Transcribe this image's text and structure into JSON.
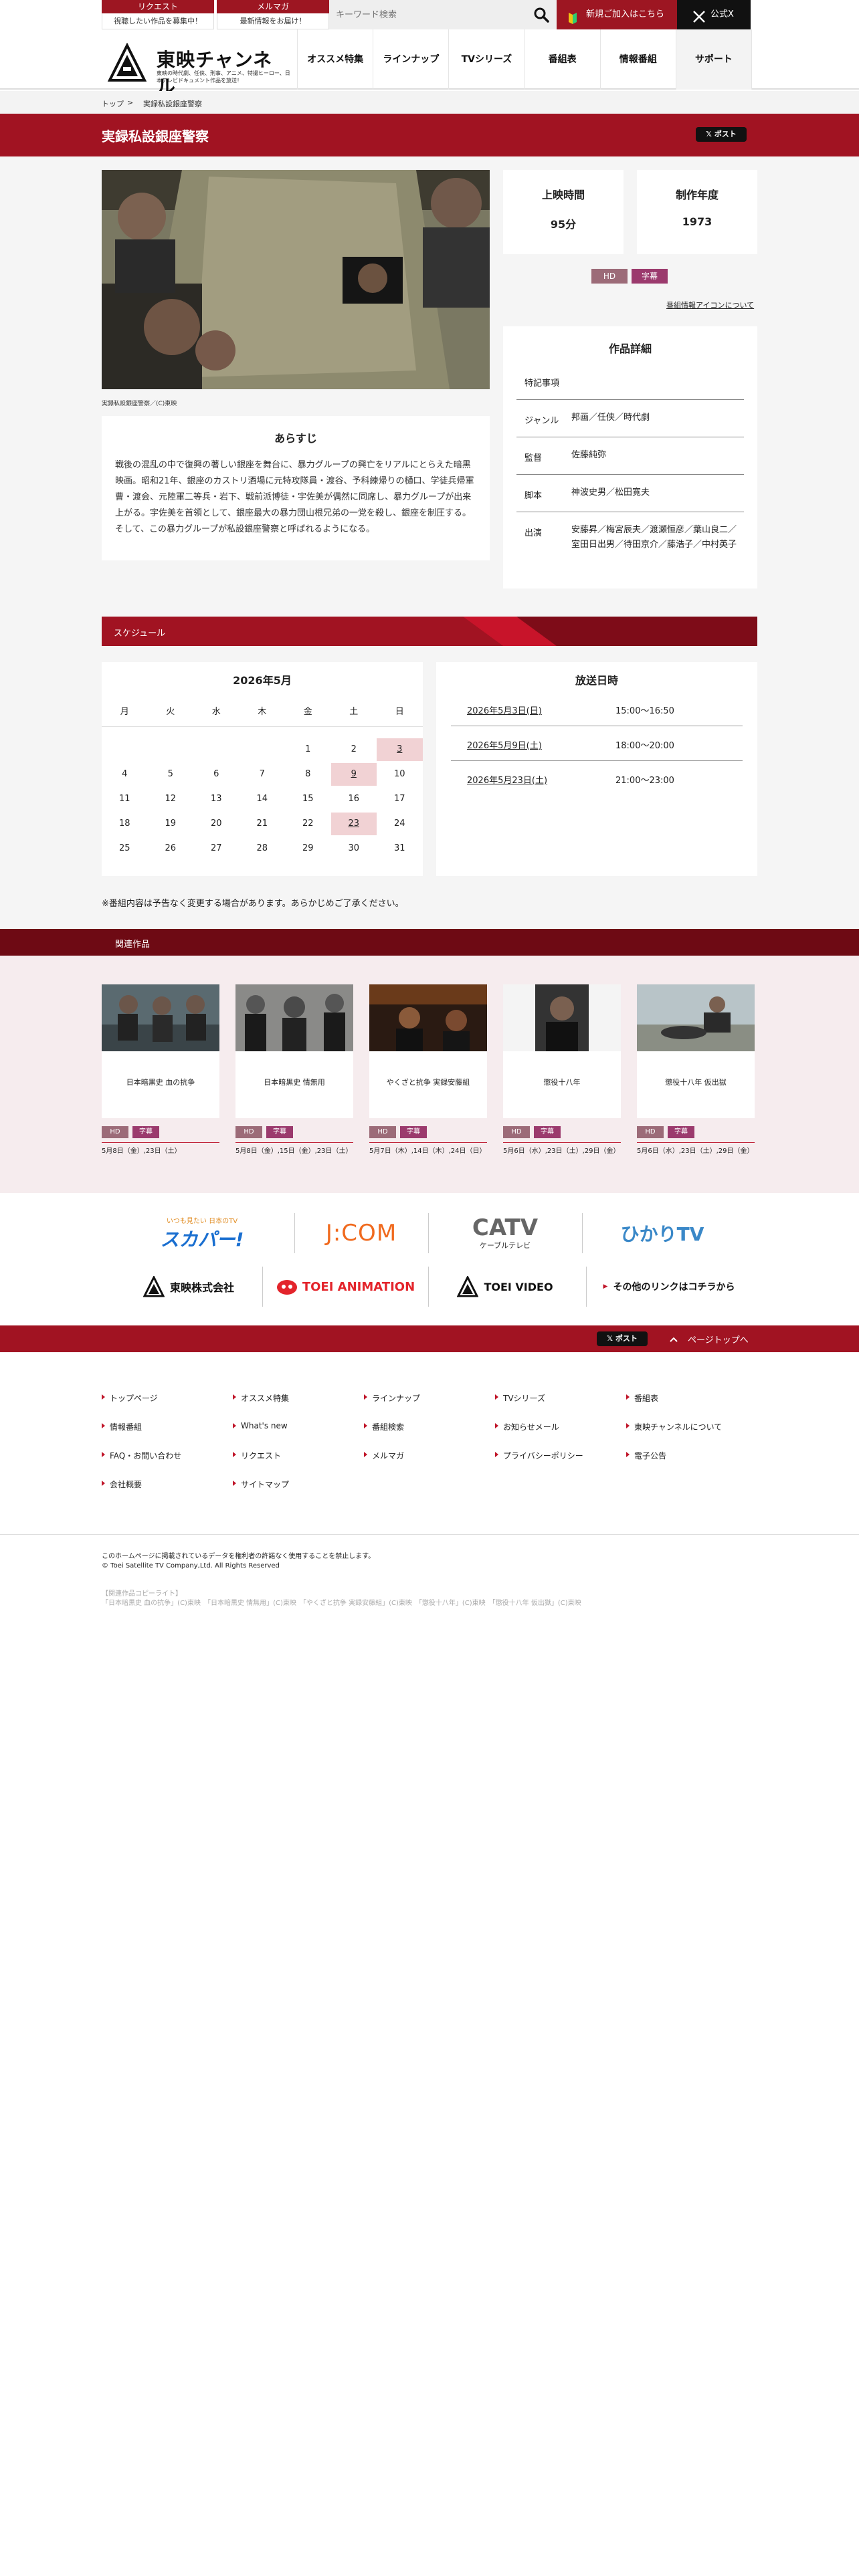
{
  "topbar": {
    "request_label": "リクエスト",
    "request_sub": "視聴したい作品を募集中！",
    "mailmag_label": "メルマガ",
    "mailmag_sub": "最新情報をお届け！",
    "search_placeholder": "キーワード検索",
    "newjoin_label": "新規ご加入はこちら",
    "x_label": "公式X"
  },
  "header": {
    "brand": "東映チャンネル",
    "tagline": "東映の時代劇、任侠、刑事、アニメ、特撮ヒーロー、日本テレビドキュメント作品を放送！",
    "nav": [
      "オススメ特集",
      "ラインナップ",
      "TVシリーズ",
      "番組表",
      "情報番組",
      "サポート"
    ]
  },
  "breadcrumb": {
    "home": "トップ",
    "sep": ">",
    "current": "実録私設銀座警察"
  },
  "title": {
    "text": "実録私設銀座警察",
    "post_label": "ポスト"
  },
  "photo_caption": "実録私設銀座警察／(C)東映",
  "synopsis": {
    "heading": "あらすじ",
    "text": "戦後の混乱の中で復興の著しい銀座を舞台に、暴力グループの興亡をリアルにとらえた暗黒映画。昭和21年、銀座のカストリ酒場に元特攻隊員・渡谷、予科練帰りの樋口、学徒兵帰軍曹・渡会、元陸軍二等兵・岩下、戦前派博徒・宇佐美が偶然に同席し、暴力グループが出来上がる。宇佐美を首領として、銀座最大の暴力団山根兄弟の一党を殺し、銀座を制圧する。そして、この暴力グループが私設銀座警察と呼ばれるようになる。"
  },
  "info": {
    "runtime_label": "上映時間",
    "runtime_value": "95分",
    "year_label": "制作年度",
    "year_value": "1973",
    "badge_hd": "HD",
    "badge_sub": "字幕",
    "icon_link": "番組情報アイコンについて"
  },
  "details": {
    "heading": "作品詳細",
    "rows": [
      {
        "key": "特記事項",
        "value": ""
      },
      {
        "key": "ジャンル",
        "value": "邦画／任侠／時代劇"
      },
      {
        "key": "監督",
        "value": "佐藤純弥"
      },
      {
        "key": "脚本",
        "value": "神波史男／松田寛夫"
      },
      {
        "key": "出演",
        "value": "安藤昇／梅宮辰夫／渡瀬恒彦／葉山良二／室田日出男／待田京介／藤浩子／中村英子"
      }
    ]
  },
  "schedule": {
    "section_title": "スケジュール",
    "month": "2026年5月",
    "weekdays": [
      "月",
      "火",
      "水",
      "木",
      "金",
      "土",
      "日"
    ],
    "weeks": [
      [
        "",
        "",
        "",
        "",
        "1",
        "2",
        "3"
      ],
      [
        "4",
        "5",
        "6",
        "7",
        "8",
        "9",
        "10"
      ],
      [
        "11",
        "12",
        "13",
        "14",
        "15",
        "16",
        "17"
      ],
      [
        "18",
        "19",
        "20",
        "21",
        "22",
        "23",
        "24"
      ],
      [
        "25",
        "26",
        "27",
        "28",
        "29",
        "30",
        "31"
      ]
    ],
    "highlight_days": [
      "3",
      "9",
      "23"
    ],
    "air_heading": "放送日時",
    "airings": [
      {
        "date": "2026年5月3日(日)",
        "time": "15:00〜16:50"
      },
      {
        "date": "2026年5月9日(土)",
        "time": "18:00〜20:00"
      },
      {
        "date": "2026年5月23日(土)",
        "time": "21:00〜23:00"
      }
    ],
    "note": "※番組内容は予告なく変更する場合があります。あらかじめご了承ください。"
  },
  "related": {
    "section_title": "関連作品",
    "items": [
      {
        "title": "日本暗黒史 血の抗争",
        "dates": "5月8日（金）,23日（土）"
      },
      {
        "title": "日本暗黒史 情無用",
        "dates": "5月8日（金）,15日（金）,23日（土）"
      },
      {
        "title": "やくざと抗争 実録安藤組",
        "dates": "5月7日（木）,14日（木）,24日（日）"
      },
      {
        "title": "懲役十八年",
        "dates": "5月6日（水）,23日（土）,29日（金）"
      },
      {
        "title": "懲役十八年 仮出獄",
        "dates": "5月6日（水）,23日（土）,29日（金）"
      }
    ],
    "badge_hd": "HD",
    "badge_sub": "字幕"
  },
  "partners": {
    "skyperfect": "スカパー!",
    "skyperfect_sub": "いつも見たい 日本のTV",
    "jcom": "J:COM",
    "catv": "CATV",
    "catv_sub": "ケーブルテレビ",
    "hikari": "ひかりTV",
    "toei": "東映株式会社",
    "toei_anim": "TOEI ANIMATION",
    "toei_video": "TOEI VIDEO",
    "more_links": "その他のリンクはコチラから"
  },
  "pagetop": {
    "post_label": "ポスト",
    "label": "ページトップへ"
  },
  "footer": {
    "links": [
      [
        "トップページ",
        "オススメ特集",
        "ラインナップ",
        "TVシリーズ",
        "番組表"
      ],
      [
        "情報番組",
        "What's new",
        "番組検索",
        "お知らせメール",
        "東映チャンネルについて"
      ],
      [
        "FAQ・お問い合わせ",
        "リクエスト",
        "メルマガ",
        "プライバシーポリシー",
        "電子公告"
      ],
      [
        "会社概要",
        "サイトマップ"
      ]
    ],
    "notice": "このホームページに掲載されているデータを権利者の許諾なく使用することを禁止します。",
    "copyright": "© Toei Satellite TV Company,Ltd. All Rights Reserved",
    "related_copy_heading": "【関連作品コピーライト】",
    "related_copy": "「日本暗黒史 血の抗争」(C)東映　「日本暗黒史 情無用」(C)東映　「やくざと抗争 実録安藤組」(C)東映　「懲役十八年」(C)東映　「懲役十八年 仮出獄」(C)東映"
  },
  "colors": {
    "brand_red": "#a11322",
    "dark_red": "#6e0a14",
    "badge_hd": "#9c6b78",
    "badge_sub": "#9b3a6d",
    "highlight": "#f1d2d4"
  }
}
